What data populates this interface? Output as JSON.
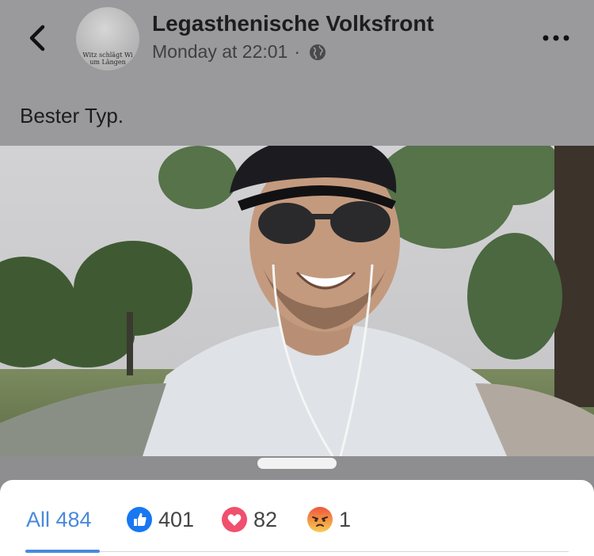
{
  "post": {
    "page_name": "Legasthenische Volksfront",
    "timestamp": "Monday at 22:01",
    "separator": "·",
    "text": "Bester Typ.",
    "avatar_text": "Witz schlägt Wi\num Längen",
    "privacy_icon": "globe-icon"
  },
  "header": {
    "back_icon": "chevron-left-icon",
    "more_icon": "more-horizontal-icon"
  },
  "reactions": {
    "tabs": [
      {
        "label": "All",
        "count": "484",
        "icon": null
      },
      {
        "label": "",
        "count": "401",
        "icon": "like-icon",
        "color": "#1877f2"
      },
      {
        "label": "",
        "count": "82",
        "icon": "love-icon",
        "color": "#f0506e"
      },
      {
        "label": "",
        "count": "1",
        "icon": "angry-icon",
        "color": "#f2994a"
      }
    ],
    "active_tab": "All",
    "all_label": "All 484"
  },
  "colors": {
    "accent": "#4a89dc",
    "dim_overlay": "#9a9a9c"
  }
}
